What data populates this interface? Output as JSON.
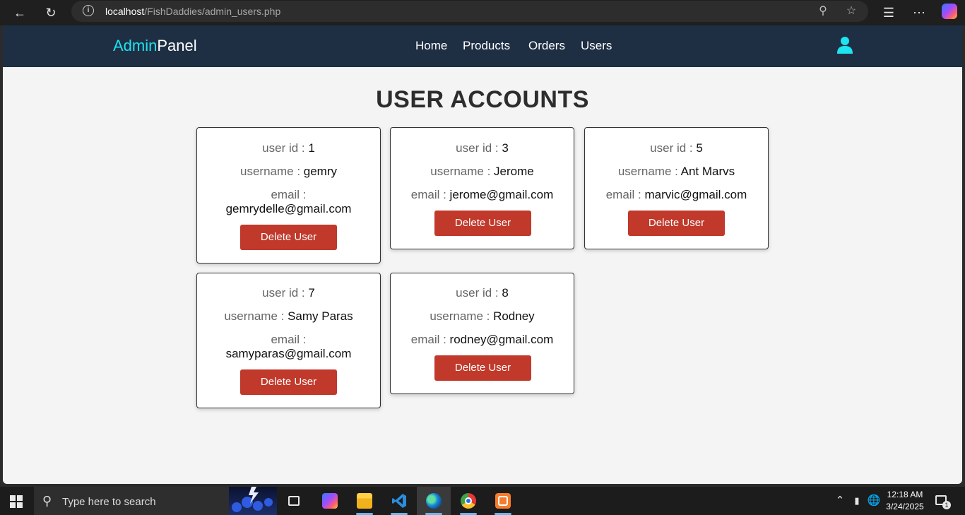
{
  "browser": {
    "url_host": "localhost",
    "url_path": "/FishDaddies/admin_users.php",
    "back_icon": "back-arrow-icon",
    "refresh_icon": "refresh-icon"
  },
  "navbar": {
    "brand_accent": "Admin",
    "brand_rest": "Panel",
    "links": [
      "Home",
      "Products",
      "Orders",
      "Users"
    ],
    "accent_color": "#1ee4f0",
    "background": "#1e2f44"
  },
  "page": {
    "title": "USER ACCOUNTS",
    "user_id_label": "user id : ",
    "username_label": "username : ",
    "email_label": "email : ",
    "delete_label": "Delete User",
    "delete_color": "#c0392b"
  },
  "users": [
    {
      "id": "1",
      "username": "gemry",
      "email": "gemrydelle@gmail.com"
    },
    {
      "id": "3",
      "username": "Jerome",
      "email": "jerome@gmail.com"
    },
    {
      "id": "5",
      "username": "Ant Marvs",
      "email": "marvic@gmail.com"
    },
    {
      "id": "7",
      "username": "Samy Paras",
      "email": "samyparas@gmail.com"
    },
    {
      "id": "8",
      "username": "Rodney",
      "email": "rodney@gmail.com"
    }
  ],
  "taskbar": {
    "search_placeholder": "Type here to search",
    "time": "12:18 AM",
    "date": "3/24/2025",
    "notification_count": "1"
  }
}
